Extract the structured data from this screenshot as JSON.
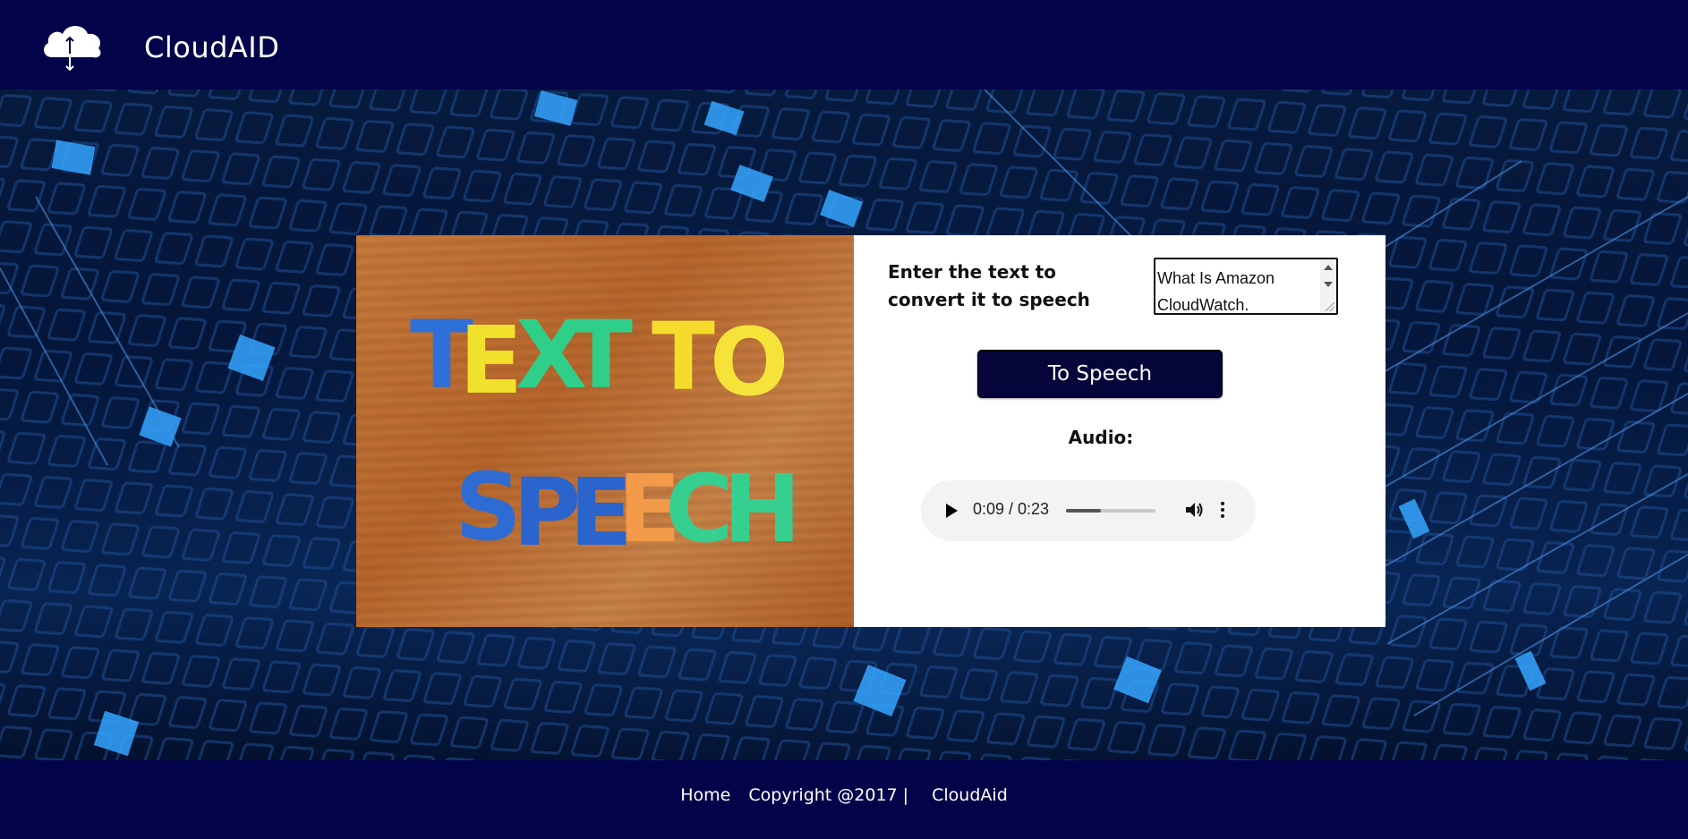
{
  "header": {
    "brand": "CloudAID",
    "logo_icon": "cloud-upload-download-icon"
  },
  "form": {
    "prompt": "Enter the text to convert it to speech",
    "textarea_value": "What Is Amazon CloudWatch.",
    "button_label": "To Speech",
    "audio_label": "Audio:"
  },
  "image": {
    "line1": "TEXT TO",
    "line2": "SPEECH"
  },
  "player": {
    "time": "0:09 / 0:23",
    "progress": 0.39,
    "icons": [
      "play-icon",
      "volume-icon",
      "more-options-icon"
    ]
  },
  "footer": {
    "home": "Home",
    "copyright": "Copyright @2017 |",
    "site": "CloudAid"
  },
  "colors": {
    "header_bg": "#03034a",
    "button_bg": "#05053a",
    "card_bg": "#ffffff"
  }
}
